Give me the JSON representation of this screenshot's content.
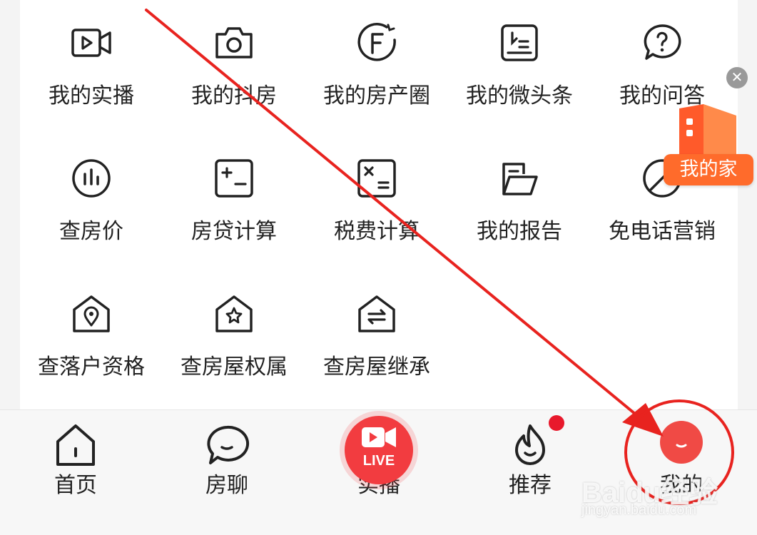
{
  "grid": {
    "row1": [
      {
        "label": "我的实播",
        "icon": "video-camera-icon"
      },
      {
        "label": "我的抖房",
        "icon": "camera-icon"
      },
      {
        "label": "我的房产圈",
        "icon": "f-circle-icon"
      },
      {
        "label": "我的微头条",
        "icon": "note-pen-icon"
      },
      {
        "label": "我的问答",
        "icon": "question-bubble-icon"
      }
    ],
    "row2": [
      {
        "label": "查房价",
        "icon": "bar-chart-circle-icon"
      },
      {
        "label": "房贷计算",
        "icon": "plus-minus-calculator-icon"
      },
      {
        "label": "税费计算",
        "icon": "times-equals-calculator-icon"
      },
      {
        "label": "我的报告",
        "icon": "folder-icon"
      },
      {
        "label": "免电话营销",
        "icon": "no-phone-icon"
      }
    ],
    "row3": [
      {
        "label": "查落户资格",
        "icon": "house-location-icon"
      },
      {
        "label": "查房屋权属",
        "icon": "house-star-icon"
      },
      {
        "label": "查房屋继承",
        "icon": "house-transfer-icon"
      }
    ]
  },
  "tabbar": {
    "home": {
      "label": "首页",
      "icon": "home-icon"
    },
    "chat": {
      "label": "房聊",
      "icon": "chat-bubble-icon"
    },
    "live": {
      "label": "实播",
      "badge": "LIVE",
      "icon": "live-video-icon"
    },
    "recommend": {
      "label": "推荐",
      "icon": "flame-icon"
    },
    "me": {
      "label": "我的",
      "icon": "avatar-icon"
    }
  },
  "floating": {
    "label": "我的家",
    "close_icon": "close-icon",
    "icon": "building-icon"
  },
  "watermark": {
    "text": "Baidu经验",
    "sub": "jingyan.baidu.com"
  },
  "colors": {
    "accent": "#f23c40",
    "arrow": "#e8231f",
    "badge": "#e8192c",
    "orange": "#ff6b2b"
  }
}
